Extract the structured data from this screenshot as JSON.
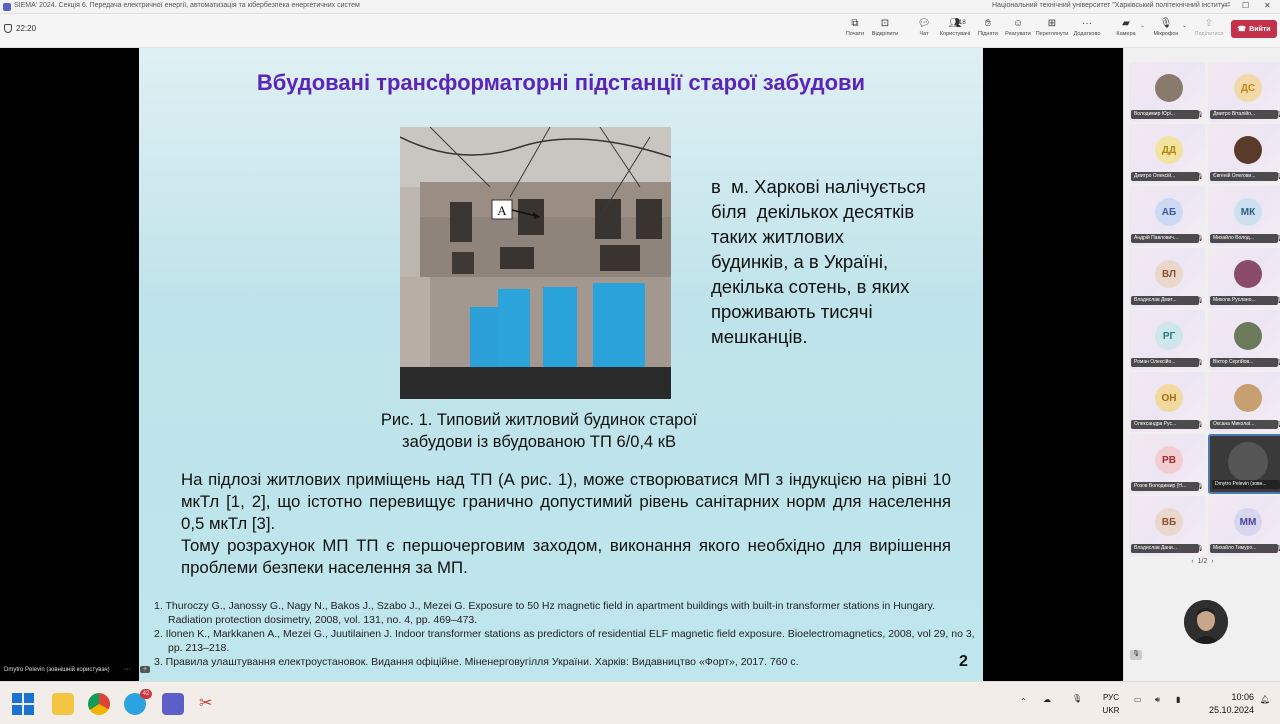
{
  "titlebar": {
    "title": "SIEMA' 2024. Секція 6. Передача електричної енергії, автоматизація та кібербезпека енергетичних систем",
    "org": "Національний технічний університет \"Харківський політехнічний інститут\""
  },
  "toolbar": {
    "timer": "22:20",
    "buttons": [
      {
        "label": "Почати",
        "icon": "record-icon"
      },
      {
        "label": "Відкріпити",
        "icon": "unpin-icon"
      },
      {
        "label": "Чат",
        "icon": "chat-icon"
      },
      {
        "label": "Користувачі",
        "icon": "people-icon",
        "count": "18"
      },
      {
        "label": "Підняти",
        "icon": "raise-hand-icon"
      },
      {
        "label": "Реагувати",
        "icon": "react-icon"
      },
      {
        "label": "Переглянути",
        "icon": "view-icon"
      },
      {
        "label": "Додатково",
        "icon": "more-icon"
      },
      {
        "label": "Камера",
        "icon": "camera-icon"
      },
      {
        "label": "Мікрофон",
        "icon": "microphone-icon"
      },
      {
        "label": "Поділитися",
        "icon": "share-icon"
      }
    ],
    "leave_label": "Вийти"
  },
  "slide": {
    "title": "Вбудовані трансформаторні підстанції старої забудови",
    "photo_marker": "A",
    "caption_line1": "Рис. 1. Типовий житловий будинок старої",
    "caption_line2": "забудови із вбудованою ТП 6/0,4 кВ",
    "side_lines": [
      "в  м. Харкові налічується",
      "біля  декількох десятків",
      "таких житлових",
      "будинків, а в Україні,",
      "декілька сотень, в яких",
      "проживають тисячі",
      "мешканців."
    ],
    "body_p1": "На підлозі житлових приміщень над ТП (А рис. 1), може створюватися МП з індукцією на рівні 10 мкТл [1, 2], що істотно перевищує гранично допустимий рівень санітарних норм для населення 0,5 мкТл [3].",
    "body_p2": "Тому розрахунок МП ТП є першочерговим заходом, виконання якого необхідно для вирішення проблеми безпеки населення за МП.",
    "refs": [
      "1. Thuroczy G., Janossy G., Nagy N., Bakos J., Szabo J., Mezei G. Exposure to 50 Hz magnetic field in apartment buildings with built-in transformer stations in Hungary. Radiation protection dosimetry, 2008, vol. 131, no. 4, pp. 469–473.",
      "2. Ilonen K., Markkanen A., Mezei G., Juutilainen J. Indoor transformer stations as predictors of residential ELF magnetic field exposure. Bioelectromagnetics, 2008, vol 29, no 3, pp. 213–218.",
      "3. Правила улаштування електроустановок. Видання офіційне. Міненерговугілля України. Харків: Видавництво «Форт», 2017. 760 с."
    ],
    "page_number": "2"
  },
  "self_view_label": "Dmytro Pelevin (зовнішній користувач)",
  "participants": [
    {
      "initials": "",
      "name": "Володимир Юрі...",
      "bg": "#8a7a6c",
      "fg": "#fff",
      "photo": true
    },
    {
      "initials": "ДС",
      "name": "Дмитро Віталійо...",
      "bg": "#f2d9a7",
      "fg": "#c18a1d"
    },
    {
      "initials": "ДД",
      "name": "Дмитро Олексій...",
      "bg": "#f2e3a0",
      "fg": "#b08a10"
    },
    {
      "initials": "",
      "name": "Євгеній Олегови...",
      "bg": "#5a3a2a",
      "fg": "#fff",
      "photo": true
    },
    {
      "initials": "АБ",
      "name": "Андрій Павлович...",
      "bg": "#cdd8f2",
      "fg": "#3c5a9e"
    },
    {
      "initials": "МК",
      "name": "Михайло Волод...",
      "bg": "#cde0ef",
      "fg": "#2f5f86"
    },
    {
      "initials": "ВЛ",
      "name": "Владислав Дмит...",
      "bg": "#ead8cd",
      "fg": "#8a5234"
    },
    {
      "initials": "",
      "name": "Микола Русланo...",
      "bg": "#8a4a6a",
      "fg": "#fff",
      "photo": true
    },
    {
      "initials": "РГ",
      "name": "Роман Олексійо...",
      "bg": "#cfe7ea",
      "fg": "#2a7a86"
    },
    {
      "initials": "",
      "name": "Віктор Сергійов...",
      "bg": "#6a7a5a",
      "fg": "#fff",
      "photo": true
    },
    {
      "initials": "ОН",
      "name": "Олександра Рус...",
      "bg": "#f2d9a0",
      "fg": "#a0700a"
    },
    {
      "initials": "",
      "name": "Оксана Миколаї...",
      "bg": "#c6a070",
      "fg": "#fff",
      "photo": true
    },
    {
      "initials": "РВ",
      "name": "Розов Володимир (Н...",
      "bg": "#f2cdd0",
      "fg": "#9e2a38"
    },
    {
      "initials": "",
      "name": "Dmytro Pelevin (зовн...",
      "bg": "#555",
      "fg": "#fff",
      "photo": true,
      "active": true
    },
    {
      "initials": "ВБ",
      "name": "Владислав Дани...",
      "bg": "#ead8cd",
      "fg": "#8a5234"
    },
    {
      "initials": "ММ",
      "name": "Михайло Тимуро...",
      "bg": "#d8d5ef",
      "fg": "#4a4694"
    }
  ],
  "pager": "1/2",
  "taskbar": {
    "lang_line1": "РУС",
    "lang_line2": "UKR",
    "time": "10:06",
    "date": "25.10.2024",
    "telegram_badge": "42"
  }
}
